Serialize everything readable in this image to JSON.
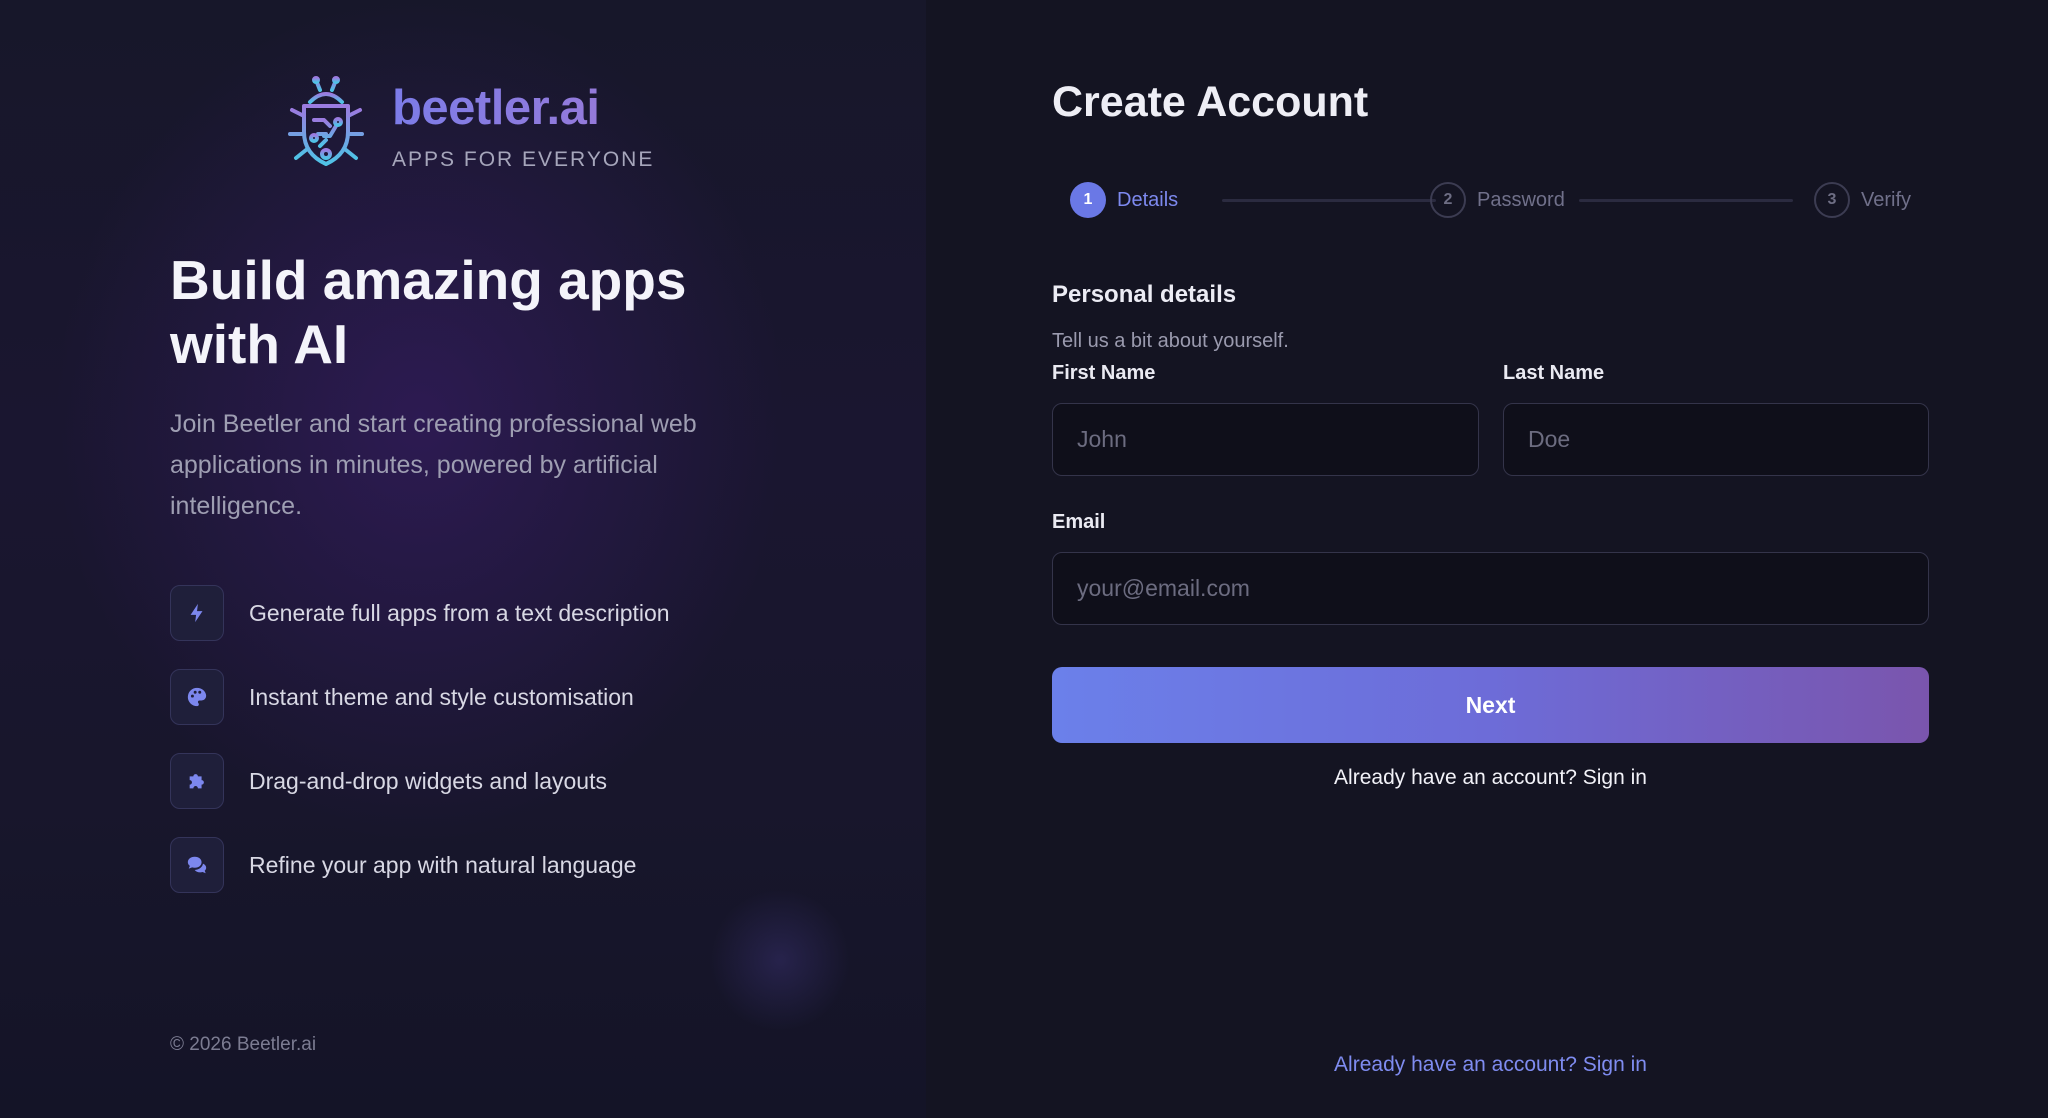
{
  "brand": {
    "name": "beetler.ai",
    "tagline": "APPS FOR EVERYONE",
    "logo_icon": "bug-circuit-icon",
    "accent_color": "#8b82e6"
  },
  "hero": {
    "title": "Build amazing apps with AI",
    "description": "Join Beetler and start creating professional web applications in minutes, powered by artificial intelligence."
  },
  "features": [
    {
      "icon": "bolt-icon",
      "label": "Generate full apps from a text description"
    },
    {
      "icon": "palette-icon",
      "label": "Instant theme and style customisation"
    },
    {
      "icon": "puzzle-icon",
      "label": "Drag-and-drop widgets and layouts"
    },
    {
      "icon": "chat-bubbles-icon",
      "label": "Refine your app with natural language"
    }
  ],
  "footer": {
    "copyright": "© 2026 Beetler.ai"
  },
  "form": {
    "title": "Create Account",
    "steps": [
      {
        "number": "1",
        "label": "Details",
        "state": "active"
      },
      {
        "number": "2",
        "label": "Password",
        "state": "inactive"
      },
      {
        "number": "3",
        "label": "Verify",
        "state": "inactive"
      }
    ],
    "section_title": "Personal details",
    "section_subtitle": "Tell us a bit about yourself.",
    "first_name": {
      "label": "First Name",
      "placeholder": "John",
      "value": ""
    },
    "last_name": {
      "label": "Last Name",
      "placeholder": "Doe",
      "value": ""
    },
    "email": {
      "label": "Email",
      "placeholder": "your@email.com",
      "value": ""
    },
    "next_label": "Next",
    "signin_inline": "Already have an account? Sign in",
    "signin_bottom": "Already have an account? Sign in"
  },
  "colors": {
    "primary": "#6a78e6",
    "button_gradient_start": "#6b80ea",
    "button_gradient_end": "#7a55ad",
    "link": "#7f8cf0"
  }
}
